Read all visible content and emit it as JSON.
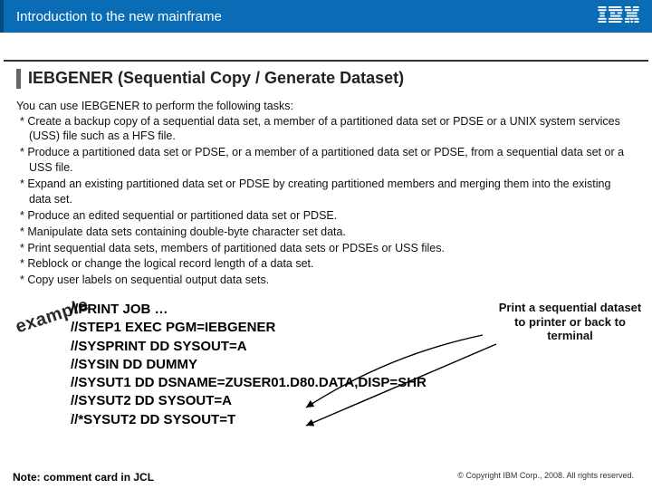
{
  "header": {
    "title": "Introduction to the new mainframe",
    "logo_label": "IBM"
  },
  "slide": {
    "title": "IEBGENER (Sequential Copy / Generate Dataset)",
    "intro": "You can use IEBGENER to perform the following tasks:",
    "bullets": [
      "* Create a backup copy of a sequential data set, a member of a partitioned data set or PDSE or a UNIX system services (USS) file such as a HFS file.",
      "* Produce a partitioned data set or PDSE, or a member of a partitioned data set or PDSE, from a sequential data set or a USS file.",
      "* Expand an existing partitioned data set or PDSE by creating partitioned members and merging them into the existing data set.",
      "* Produce an edited sequential or partitioned data set or PDSE.",
      "* Manipulate data sets containing double-byte character set data.",
      "* Print sequential data sets, members of partitioned data sets or PDSEs or USS files.",
      "* Reblock or change the logical record length of a data set.",
      "* Copy user labels on sequential output data sets."
    ]
  },
  "example": {
    "label": "example",
    "lines": [
      "//PRINT JOB …",
      "//STEP1 EXEC PGM=IEBGENER",
      "//SYSPRINT DD SYSOUT=A",
      "//SYSIN DD DUMMY",
      "//SYSUT1 DD DSNAME=ZUSER01.D80.DATA,DISP=SHR",
      "//SYSUT2 DD SYSOUT=A",
      "//*SYSUT2 DD SYSOUT=T"
    ],
    "annotation": "Print a sequential dataset to printer or back to terminal"
  },
  "footer": {
    "note": "Note: comment card in JCL",
    "copyright": "© Copyright IBM Corp., 2008. All rights reserved."
  }
}
